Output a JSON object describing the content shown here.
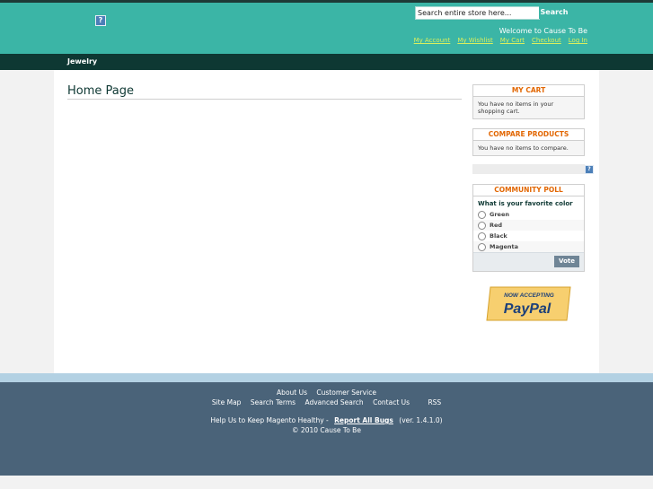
{
  "header": {
    "logo_icon": "help-square-icon",
    "search": {
      "placeholder": "Search entire store here...",
      "value": "Search entire store here...",
      "button": "Search"
    },
    "welcome": "Welcome to Cause To Be",
    "links": [
      "My Account",
      "My Wishlist",
      "My Cart",
      "Checkout",
      "Log In"
    ]
  },
  "nav": {
    "items": [
      "Jewelry"
    ]
  },
  "main": {
    "title": "Home Page"
  },
  "sidebar": {
    "cart": {
      "title": "MY CART",
      "body": "You have no items in your shopping cart."
    },
    "compare": {
      "title": "COMPARE PRODUCTS",
      "body": "You have no items to compare."
    },
    "help_icon": "question-icon",
    "poll": {
      "title": "COMMUNITY POLL",
      "question": "What is your favorite color",
      "options": [
        "Green",
        "Red",
        "Black",
        "Magenta"
      ],
      "vote": "Vote"
    },
    "paypal": {
      "line1": "NOW ACCEPTING",
      "line2": "PayPal"
    }
  },
  "footer": {
    "row1": [
      "About Us",
      "Customer Service"
    ],
    "row2": [
      "Site Map",
      "Search Terms",
      "Advanced Search",
      "Contact Us",
      "RSS"
    ],
    "help_prefix": "Help Us to Keep Magento Healthy -",
    "help_link": "Report All Bugs",
    "version": "(ver. 1.4.1.0)",
    "copyright": "© 2010 Cause To Be"
  },
  "colors": {
    "header": "#3bb5a6",
    "nav": "#0e3833",
    "footer": "#4a6379",
    "accent": "#e26703"
  }
}
